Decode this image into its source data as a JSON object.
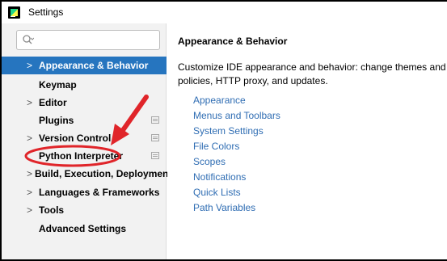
{
  "window": {
    "title": "Settings"
  },
  "search": {
    "placeholder": ""
  },
  "sidebar": {
    "items": [
      {
        "label": "Appearance & Behavior",
        "chevron": true,
        "selected": true,
        "badge": false
      },
      {
        "label": "Keymap",
        "chevron": false,
        "selected": false,
        "badge": false
      },
      {
        "label": "Editor",
        "chevron": true,
        "selected": false,
        "badge": false
      },
      {
        "label": "Plugins",
        "chevron": false,
        "selected": false,
        "badge": true
      },
      {
        "label": "Version Control",
        "chevron": true,
        "selected": false,
        "badge": true
      },
      {
        "label": "Python Interpreter",
        "chevron": false,
        "selected": false,
        "badge": true
      },
      {
        "label": "Build, Execution, Deployment",
        "chevron": true,
        "selected": false,
        "badge": false
      },
      {
        "label": "Languages & Frameworks",
        "chevron": true,
        "selected": false,
        "badge": false
      },
      {
        "label": "Tools",
        "chevron": true,
        "selected": false,
        "badge": false
      },
      {
        "label": "Advanced Settings",
        "chevron": false,
        "selected": false,
        "badge": false
      }
    ]
  },
  "main": {
    "title": "Appearance & Behavior",
    "description_line1": "Customize IDE appearance and behavior: change themes and font siz",
    "description_line2": "policies, HTTP proxy, and updates.",
    "links": [
      "Appearance",
      "Menus and Toolbars",
      "System Settings",
      "File Colors",
      "Scopes",
      "Notifications",
      "Quick Lists",
      "Path Variables"
    ]
  },
  "icons": {
    "app": "pycharm-app-icon",
    "search": "search-icon",
    "badge": "project-level-icon"
  },
  "colors": {
    "selection": "#2675bf",
    "link": "#2f6db3",
    "annotation": "#e0252a",
    "sidebar_bg": "#f2f2f2"
  }
}
